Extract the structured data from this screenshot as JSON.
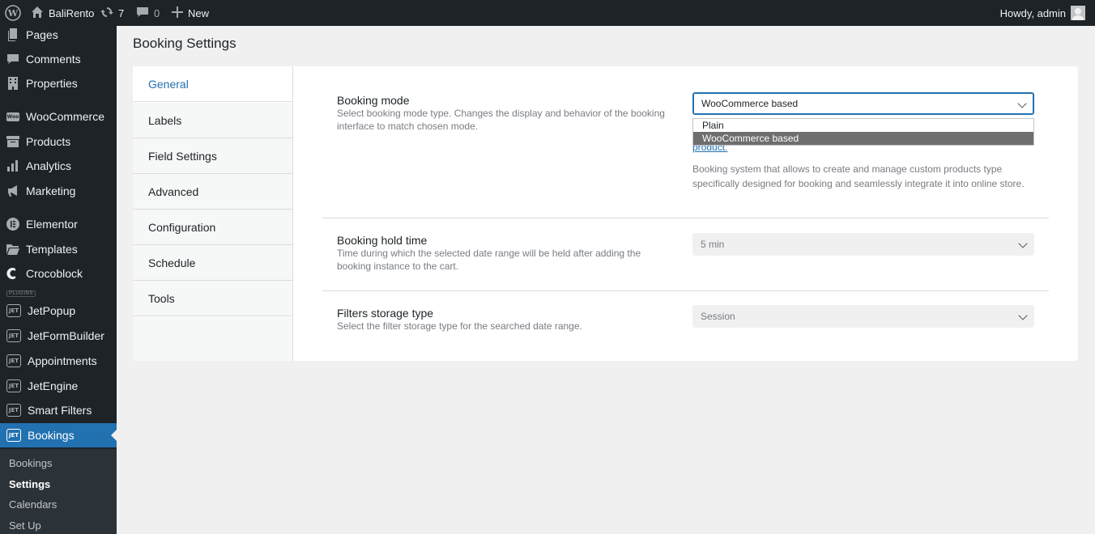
{
  "adminbar": {
    "site_name": "BaliRento",
    "updates_count": "7",
    "comments_count": "0",
    "new_label": "New",
    "howdy": "Howdy, admin"
  },
  "sidebar": {
    "items": [
      {
        "label": "Pages",
        "icon": "pages-icon"
      },
      {
        "label": "Comments",
        "icon": "comments-icon"
      },
      {
        "label": "Properties",
        "icon": "building-icon"
      },
      {
        "label": "WooCommerce",
        "icon": "woocommerce-icon"
      },
      {
        "label": "Products",
        "icon": "products-icon"
      },
      {
        "label": "Analytics",
        "icon": "analytics-icon"
      },
      {
        "label": "Marketing",
        "icon": "megaphone-icon"
      },
      {
        "label": "Elementor",
        "icon": "elementor-icon"
      },
      {
        "label": "Templates",
        "icon": "folder-icon"
      },
      {
        "label": "Crocoblock",
        "icon": "crocoblock-icon"
      },
      {
        "label": "JetPopup",
        "icon": "jet-icon"
      },
      {
        "label": "JetFormBuilder",
        "icon": "jet-icon"
      },
      {
        "label": "Appointments",
        "icon": "jet-icon"
      },
      {
        "label": "JetEngine",
        "icon": "jet-icon"
      },
      {
        "label": "Smart Filters",
        "icon": "jet-icon"
      },
      {
        "label": "Bookings",
        "icon": "jet-icon"
      }
    ],
    "plugins_separator": "PLUGINS",
    "jet_badge": "JET",
    "woo_badge": "Woo",
    "submenu": [
      "Bookings",
      "Settings",
      "Calendars",
      "Set Up"
    ]
  },
  "page": {
    "title": "Booking Settings"
  },
  "tabs": [
    "General",
    "Labels",
    "Field Settings",
    "Advanced",
    "Configuration",
    "Schedule",
    "Tools"
  ],
  "settings": {
    "booking_mode": {
      "label": "Booking mode",
      "desc": "Select booking mode type. Changes the display and behavior of the booking interface to match chosen mode.",
      "value": "WooCommerce based",
      "options": [
        "Plain",
        "WooCommerce based"
      ],
      "link_fragment": "product",
      "link_suffix": ".",
      "info": "Booking system that allows to create and manage custom products type specifically designed for booking and seamlessly integrate it into online store."
    },
    "hold_time": {
      "label": "Booking hold time",
      "desc": "Time during which the selected date range will be held after adding the booking instance to the cart.",
      "value": "5 min"
    },
    "filters_storage": {
      "label": "Filters storage type",
      "desc": "Select the filter storage type for the searched date range.",
      "value": "Session"
    }
  },
  "colors": {
    "accent": "#2271b1",
    "sidebar_bg": "#1d2327",
    "submenu_bg": "#2c3338"
  }
}
